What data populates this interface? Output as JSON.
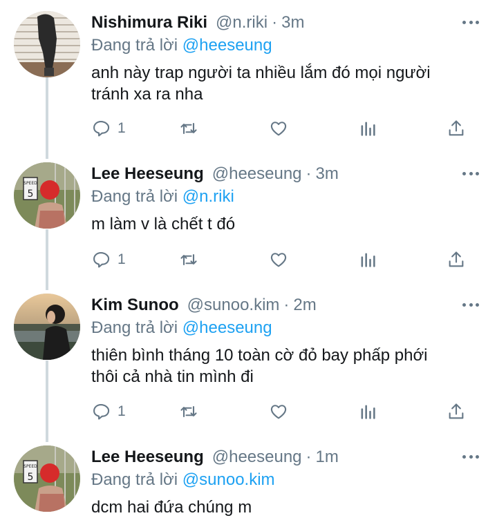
{
  "reply_prefix": "Đang trả lời",
  "tweets": [
    {
      "name": "Nishimura Riki",
      "handle": "@n.riki",
      "dot": "·",
      "time": "3m",
      "reply_to": "@heeseung",
      "text_lines": [
        "anh này trap người ta nhiều lắm đó mọi người",
        "tránh xa ra nha"
      ],
      "reply_count": "1",
      "avatar": "person-by-window"
    },
    {
      "name": "Lee Heeseung",
      "handle": "@heeseung",
      "dot": "·",
      "time": "3m",
      "reply_to": "@n.riki",
      "text_lines": [
        "m làm v là chết t đó"
      ],
      "reply_count": "1",
      "avatar": "speed-limit-sign"
    },
    {
      "name": "Kim Sunoo",
      "handle": "@sunoo.kim",
      "dot": "·",
      "time": "2m",
      "reply_to": "@heeseung",
      "text_lines": [
        "thiên bình tháng 10 toàn cờ đỏ bay phấp phới",
        "thôi cả nhà tin mình đi"
      ],
      "reply_count": "1",
      "avatar": "riverside-sunset"
    },
    {
      "name": "Lee Heeseung",
      "handle": "@heeseung",
      "dot": "·",
      "time": "1m",
      "reply_to": "@sunoo.kim",
      "text_lines": [
        "dcm hai đứa chúng m"
      ],
      "avatar": "speed-limit-sign"
    }
  ],
  "colors": {
    "text": "#14171a",
    "muted": "#657786",
    "link": "#1da1f2",
    "thread_line": "#cfd9de"
  },
  "icons": [
    "reply-icon",
    "retweet-icon",
    "like-icon",
    "analytics-icon",
    "share-icon",
    "more-icon"
  ]
}
